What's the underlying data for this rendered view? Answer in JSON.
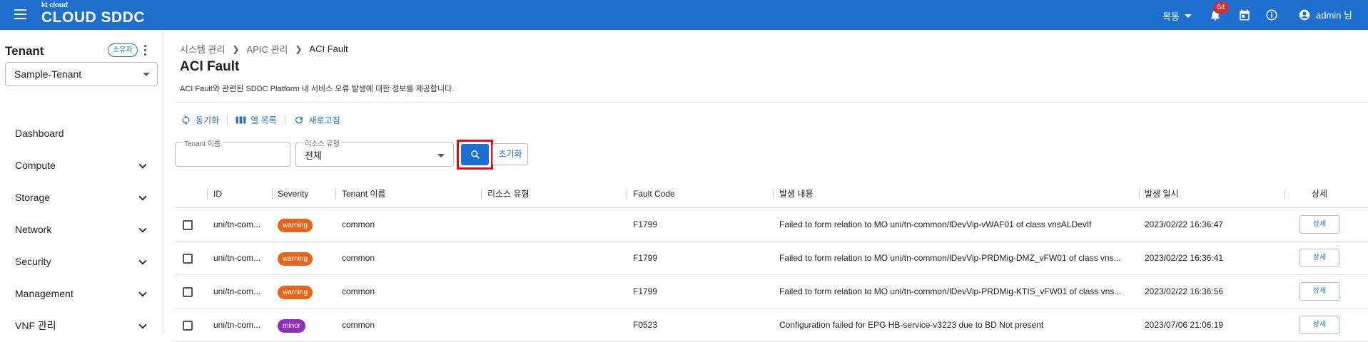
{
  "header": {
    "brand_top": "kt cloud",
    "brand_main": "CLOUD SDDC",
    "region": "목동",
    "notification_count": "64",
    "user": "admin 님",
    "bar_color": "#1e6fd0"
  },
  "sidebar": {
    "title": "Tenant",
    "owner_chip": "소유자",
    "selected_tenant": "Sample-Tenant",
    "items": [
      {
        "label": "Dashboard",
        "expandable": false
      },
      {
        "label": "Compute",
        "expandable": true
      },
      {
        "label": "Storage",
        "expandable": true
      },
      {
        "label": "Network",
        "expandable": true
      },
      {
        "label": "Security",
        "expandable": true
      },
      {
        "label": "Management",
        "expandable": true
      },
      {
        "label": "VNF 관리",
        "expandable": true
      }
    ]
  },
  "breadcrumb": [
    "시스템 관리",
    "APIC 관리",
    "ACI Fault"
  ],
  "page": {
    "title": "ACI Fault",
    "description": "ACI Fault와 관련된 SDDC Platform 내 서비스 오류 발생에 대한 정보를 제공합니다."
  },
  "toolbar": {
    "sync": "동기화",
    "columns": "열 목록",
    "refresh": "새로고침"
  },
  "filters": {
    "tenant_label": "Tenant 이름",
    "tenant_value": "",
    "resource_label": "리소스 유형",
    "resource_value": "전체",
    "reset": "초기화"
  },
  "table": {
    "columns": [
      "ID",
      "Severity",
      "Tenant 이름",
      "리소스 유형",
      "Fault Code",
      "발생 내용",
      "발생 일시",
      "상세"
    ],
    "rows": [
      {
        "id": "uni/tn-com...",
        "severity": "warning",
        "severity_color": "#e8641b",
        "tenant": "common",
        "resource": "",
        "code": "F1799",
        "content": "Failed to form relation to MO uni/tn-common/lDevVip-vWAF01 of class vnsALDevIf",
        "time": "2023/02/22 16:36:47",
        "detail": "상세"
      },
      {
        "id": "uni/tn-com...",
        "severity": "warning",
        "severity_color": "#e8641b",
        "tenant": "common",
        "resource": "",
        "code": "F1799",
        "content": "Failed to form relation to MO uni/tn-common/lDevVip-PRDMig-DMZ_vFW01 of class vns...",
        "time": "2023/02/22 16:36:41",
        "detail": "상세"
      },
      {
        "id": "uni/tn-com...",
        "severity": "warning",
        "severity_color": "#e8641b",
        "tenant": "common",
        "resource": "",
        "code": "F1799",
        "content": "Failed to form relation to MO uni/tn-common/lDevVip-PRDMig-KTIS_vFW01 of class vns...",
        "time": "2023/02/22 16:36:56",
        "detail": "상세"
      },
      {
        "id": "uni/tn-com...",
        "severity": "minor",
        "severity_color": "#8e2fb8",
        "tenant": "common",
        "resource": "",
        "code": "F0523",
        "content": "Configuration failed for EPG HB-service-v3223 due to BD Not present",
        "time": "2023/07/06 21:06:19",
        "detail": "상세"
      }
    ]
  }
}
